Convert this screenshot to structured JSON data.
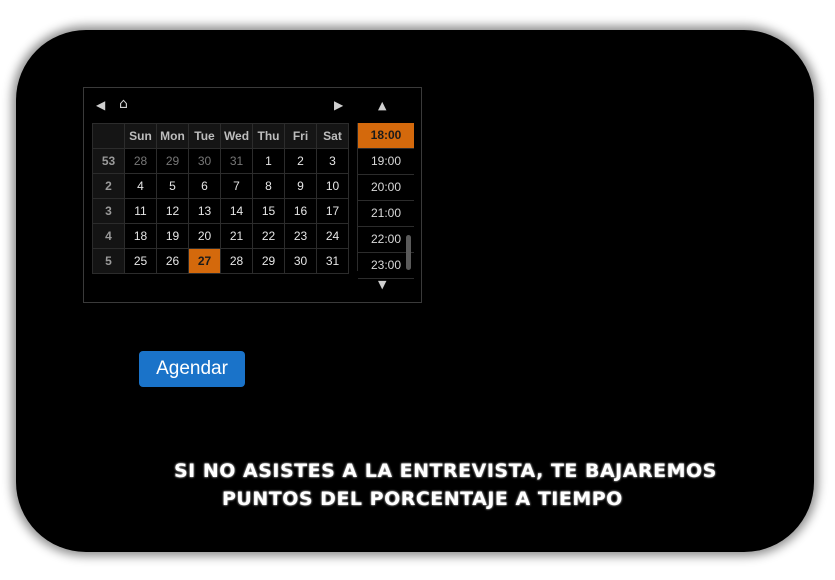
{
  "picker": {
    "nav": {
      "prev": "◀",
      "home": "⌂",
      "next": "▶"
    },
    "weekday_headers": [
      "Sun",
      "Mon",
      "Tue",
      "Wed",
      "Thu",
      "Fri",
      "Sat"
    ],
    "weeks": [
      {
        "week": "53",
        "days": [
          "28",
          "29",
          "30",
          "31",
          "1",
          "2",
          "3"
        ]
      },
      {
        "week": "2",
        "days": [
          "4",
          "5",
          "6",
          "7",
          "8",
          "9",
          "10"
        ]
      },
      {
        "week": "3",
        "days": [
          "11",
          "12",
          "13",
          "14",
          "15",
          "16",
          "17"
        ]
      },
      {
        "week": "4",
        "days": [
          "18",
          "19",
          "20",
          "21",
          "22",
          "23",
          "24"
        ]
      },
      {
        "week": "5",
        "days": [
          "25",
          "26",
          "27",
          "28",
          "29",
          "30",
          "31"
        ]
      }
    ],
    "selected_day": "27",
    "times": [
      "18:00",
      "19:00",
      "20:00",
      "21:00",
      "22:00",
      "23:00"
    ],
    "selected_time": "18:00",
    "time_up": "▲",
    "time_down": "▼"
  },
  "action": {
    "schedule_label": "Agendar"
  },
  "notice": {
    "line1": "SI NO ASISTES A LA ENTREVISTA, TE BAJAREMOS",
    "line2": "PUNTOS DEL PORCENTAJE A TIEMPO"
  },
  "colors": {
    "background": "#000000",
    "accent": "#d4690c",
    "button": "#1a73c9"
  }
}
